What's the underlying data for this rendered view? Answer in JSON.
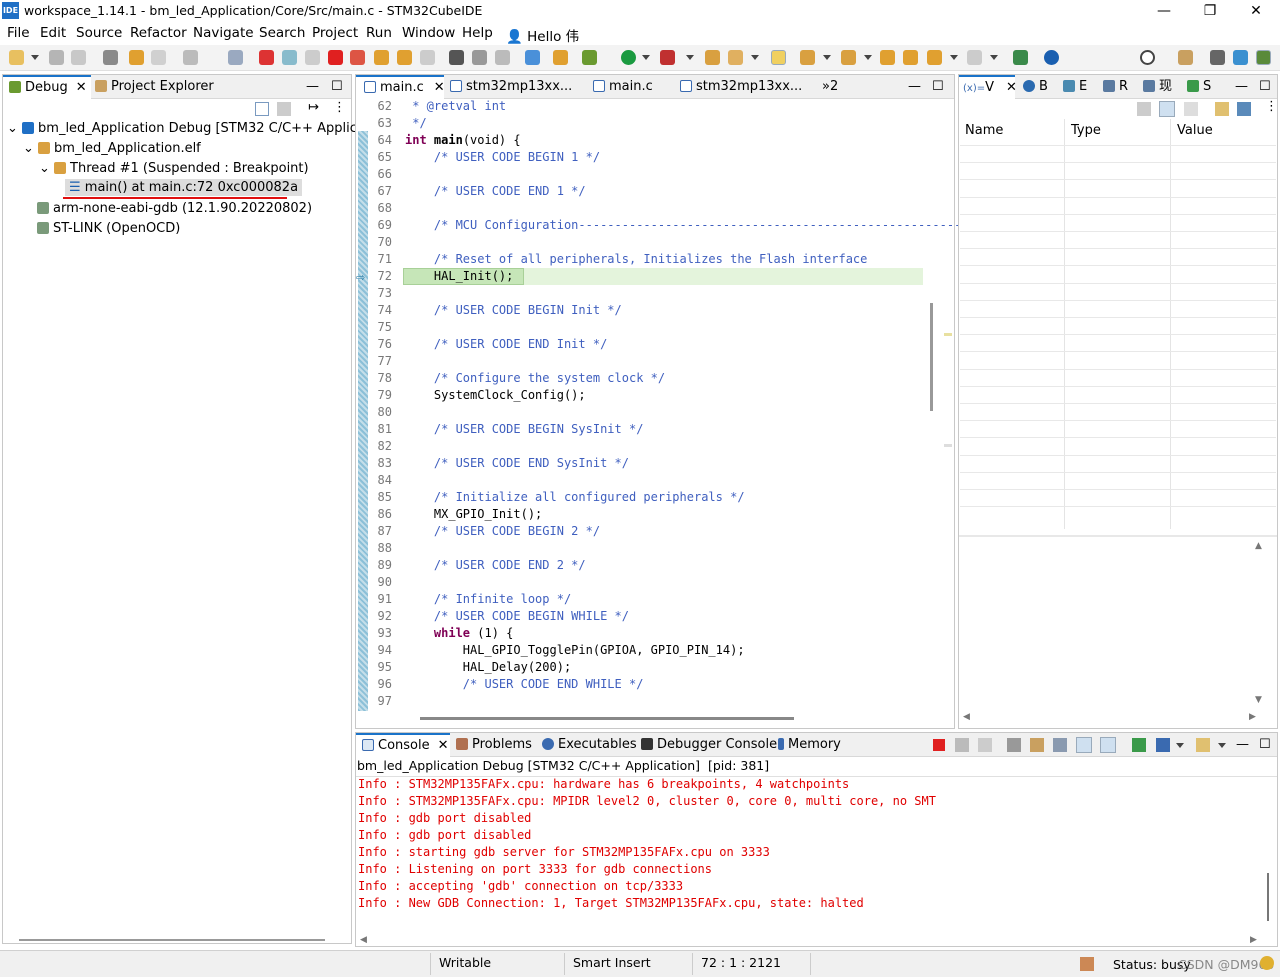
{
  "window": {
    "title": "workspace_1.14.1 - bm_led_Application/Core/Src/main.c - STM32CubeIDE",
    "logo": "IDE"
  },
  "menu": [
    "File",
    "Edit",
    "Source",
    "Refactor",
    "Navigate",
    "Search",
    "Project",
    "Run",
    "Window",
    "Help"
  ],
  "user": "Hello 伟",
  "debug_view": {
    "tabs": [
      "Debug",
      "Project Explorer"
    ],
    "tree": {
      "launch": "bm_led_Application Debug [STM32 C/C++ Applicatio",
      "elf": "bm_led_Application.elf",
      "thread": "Thread #1 (Suspended : Breakpoint)",
      "frame": "main() at main.c:72 0xc000082a",
      "gdb": "arm-none-eabi-gdb (12.1.90.20220802)",
      "stlink": "ST-LINK (OpenOCD)"
    }
  },
  "editor": {
    "tabs": [
      "main.c",
      "stm32mp13xx...",
      "main.c",
      "stm32mp13xx..."
    ],
    "overflow": "»2",
    "lines": [
      {
        "n": "62",
        "t": " * @retval int",
        "c": "cmt"
      },
      {
        "n": "63",
        "t": " */",
        "c": "cmt"
      },
      {
        "n": "64",
        "t": "int main(void) {",
        "c": "main"
      },
      {
        "n": "65",
        "t": "    /* USER CODE BEGIN 1 */",
        "c": "cmt"
      },
      {
        "n": "66",
        "t": "",
        "c": ""
      },
      {
        "n": "67",
        "t": "    /* USER CODE END 1 */",
        "c": "cmt"
      },
      {
        "n": "68",
        "t": "",
        "c": ""
      },
      {
        "n": "69",
        "t": "    /* MCU Configuration--------------------------------------------------------",
        "c": "cmt"
      },
      {
        "n": "70",
        "t": "",
        "c": ""
      },
      {
        "n": "71",
        "t": "    /* Reset of all peripherals, Initializes the Flash interface",
        "c": "cmt"
      },
      {
        "n": "72",
        "t": "    HAL_Init();",
        "c": "hl"
      },
      {
        "n": "73",
        "t": "",
        "c": ""
      },
      {
        "n": "74",
        "t": "    /* USER CODE BEGIN Init */",
        "c": "cmt"
      },
      {
        "n": "75",
        "t": "",
        "c": ""
      },
      {
        "n": "76",
        "t": "    /* USER CODE END Init */",
        "c": "cmt"
      },
      {
        "n": "77",
        "t": "",
        "c": ""
      },
      {
        "n": "78",
        "t": "    /* Configure the system clock */",
        "c": "cmt"
      },
      {
        "n": "79",
        "t": "    SystemClock_Config();",
        "c": ""
      },
      {
        "n": "80",
        "t": "",
        "c": ""
      },
      {
        "n": "81",
        "t": "    /* USER CODE BEGIN SysInit */",
        "c": "cmt"
      },
      {
        "n": "82",
        "t": "",
        "c": ""
      },
      {
        "n": "83",
        "t": "    /* USER CODE END SysInit */",
        "c": "cmt"
      },
      {
        "n": "84",
        "t": "",
        "c": ""
      },
      {
        "n": "85",
        "t": "    /* Initialize all configured peripherals */",
        "c": "cmt"
      },
      {
        "n": "86",
        "t": "    MX_GPIO_Init();",
        "c": ""
      },
      {
        "n": "87",
        "t": "    /* USER CODE BEGIN 2 */",
        "c": "cmt"
      },
      {
        "n": "88",
        "t": "",
        "c": ""
      },
      {
        "n": "89",
        "t": "    /* USER CODE END 2 */",
        "c": "cmt"
      },
      {
        "n": "90",
        "t": "",
        "c": ""
      },
      {
        "n": "91",
        "t": "    /* Infinite loop */",
        "c": "cmt"
      },
      {
        "n": "92",
        "t": "    /* USER CODE BEGIN WHILE */",
        "c": "cmt"
      },
      {
        "n": "93",
        "t": "    while (1) {",
        "c": "while"
      },
      {
        "n": "94",
        "t": "        HAL_GPIO_TogglePin(GPIOA, GPIO_PIN_14);",
        "c": ""
      },
      {
        "n": "95",
        "t": "        HAL_Delay(200);",
        "c": ""
      },
      {
        "n": "96",
        "t": "        /* USER CODE END WHILE */",
        "c": "cmt"
      },
      {
        "n": "97",
        "t": "",
        "c": ""
      }
    ]
  },
  "variables_view": {
    "tabs": [
      "V",
      "B",
      "E",
      "R",
      "现",
      "S"
    ],
    "columns": [
      "Name",
      "Type",
      "Value"
    ]
  },
  "console": {
    "tabs": [
      "Console",
      "Problems",
      "Executables",
      "Debugger Console",
      "Memory"
    ],
    "header": "bm_led_Application Debug [STM32 C/C++ Application]  [pid: 381]",
    "lines": [
      "Info : STM32MP135FAFx.cpu: hardware has 6 breakpoints, 4 watchpoints",
      "Info : STM32MP135FAFx.cpu: MPIDR level2 0, cluster 0, core 0, multi core, no SMT",
      "Info : gdb port disabled",
      "Info : gdb port disabled",
      "Info : starting gdb server for STM32MP135FAFx.cpu on 3333",
      "Info : Listening on port 3333 for gdb connections",
      "Info : accepting 'gdb' connection on tcp/3333",
      "Info : New GDB Connection: 1, Target STM32MP135FAFx.cpu, state: halted"
    ]
  },
  "status": {
    "writable": "Writable",
    "insert": "Smart Insert",
    "position": "72 : 1 : 2121",
    "busy": "Status: busy",
    "watermark": "CSDN @DM960"
  }
}
